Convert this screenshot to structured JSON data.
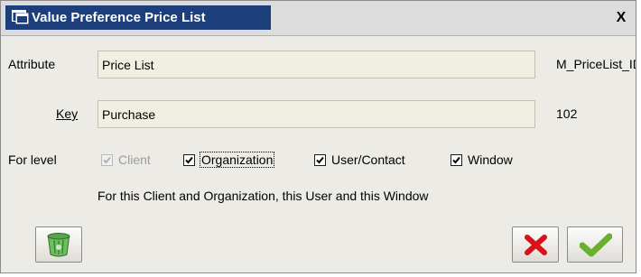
{
  "window": {
    "title": "Value Preference Price List",
    "close_label": "X"
  },
  "form": {
    "attribute_label": "Attribute",
    "attribute_value": "Price List",
    "attribute_column": "M_PriceList_ID",
    "key_label": "Key",
    "key_value": "Purchase",
    "key_id": "102",
    "level_label": "For level",
    "levels": [
      {
        "label": "Client",
        "checked": true,
        "enabled": false
      },
      {
        "label": "Organization",
        "checked": true,
        "enabled": true
      },
      {
        "label": "User/Contact",
        "checked": true,
        "enabled": true
      },
      {
        "label": "Window",
        "checked": true,
        "enabled": true
      }
    ],
    "description": "For this Client and Organization, this User and this Window"
  },
  "buttons": {
    "delete_icon": "recycle-bin-icon",
    "cancel_icon": "red-x-icon",
    "ok_icon": "green-check-icon"
  },
  "colors": {
    "title_bar": "#1c3f7c",
    "field_bg": "#f1eee2",
    "dialog_bg": "#ecebe6",
    "cancel_red": "#d8121a",
    "ok_green": "#6ab02c"
  }
}
